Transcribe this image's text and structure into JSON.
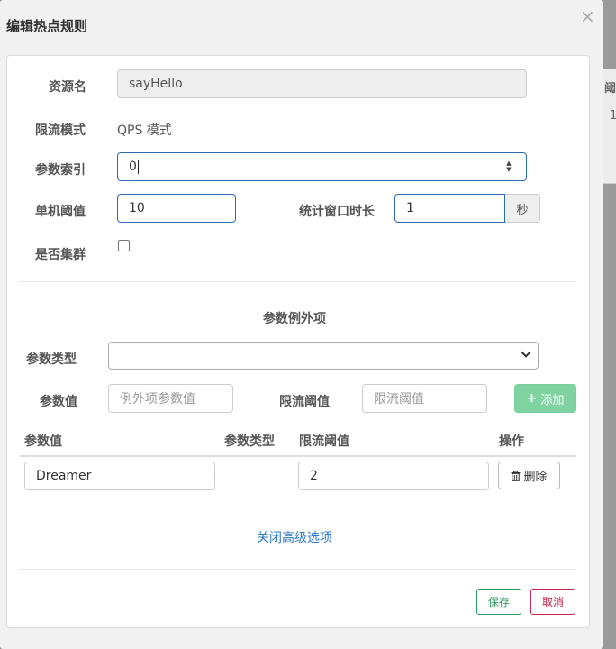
{
  "dialog": {
    "title": "编辑热点规则",
    "close_icon": "×"
  },
  "background": {
    "header_fragment": "阈",
    "cell_fragment": "1"
  },
  "form": {
    "resource_label": "资源名",
    "resource_value": "sayHello",
    "mode_label": "限流模式",
    "mode_value": "QPS 模式",
    "param_index_label": "参数索引",
    "param_index_value": "0",
    "threshold_label": "单机阈值",
    "threshold_value": "10",
    "window_label": "统计窗口时长",
    "window_value": "1",
    "window_unit": "秒",
    "cluster_label": "是否集群"
  },
  "exceptions": {
    "section_title": "参数例外项",
    "param_type_label": "参数类型",
    "param_type_value": "",
    "param_value_label": "参数值",
    "param_value_placeholder": "例外项参数值",
    "limit_label": "限流阈值",
    "limit_placeholder": "限流阈值",
    "add_button": "添加",
    "add_icon": "plus-icon",
    "table": {
      "headers": [
        "参数值",
        "参数类型",
        "限流阈值",
        "操作"
      ],
      "rows": [
        {
          "param_value": "Dreamer",
          "param_type": "",
          "limit": "2",
          "action": "删除"
        }
      ]
    }
  },
  "advanced_toggle": "关闭高级选项",
  "footer": {
    "save": "保存",
    "cancel": "取消"
  },
  "colors": {
    "primary_link": "#2d7bc4",
    "success": "#2a9a5e",
    "danger": "#c8274a",
    "add_button_bg": "#7fd3a0"
  }
}
